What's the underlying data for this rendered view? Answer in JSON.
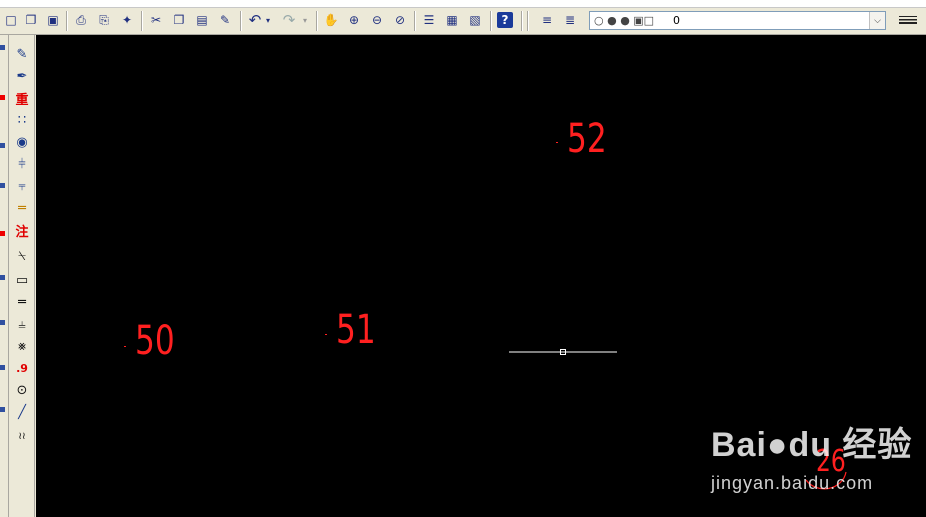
{
  "toolbar": {
    "items": [
      {
        "name": "new-drawing-icon",
        "glyph": "□"
      },
      {
        "name": "open-icon",
        "glyph": "❐"
      },
      {
        "name": "save-icon",
        "glyph": "▣"
      },
      {
        "name": "print-icon",
        "glyph": "⎙"
      },
      {
        "name": "print-preview-icon",
        "glyph": "⎘"
      },
      {
        "name": "publish-icon",
        "glyph": "✦"
      },
      {
        "name": "cut-icon",
        "glyph": "✂"
      },
      {
        "name": "copy-icon",
        "glyph": "❐"
      },
      {
        "name": "paste-icon",
        "glyph": "▤"
      },
      {
        "name": "match-properties-icon",
        "glyph": "✎"
      },
      {
        "name": "undo-icon",
        "glyph": "↶"
      },
      {
        "name": "redo-icon",
        "glyph": "↷"
      },
      {
        "name": "pan-icon",
        "glyph": "✋"
      },
      {
        "name": "zoom-realtime-icon",
        "glyph": "⊕"
      },
      {
        "name": "zoom-window-icon",
        "glyph": "⊖"
      },
      {
        "name": "zoom-previous-icon",
        "glyph": "⊘"
      },
      {
        "name": "properties-icon",
        "glyph": "☰"
      },
      {
        "name": "design-center-icon",
        "glyph": "▦"
      },
      {
        "name": "tool-palettes-icon",
        "glyph": "▧"
      },
      {
        "name": "help-icon",
        "glyph": "?"
      },
      {
        "name": "layer-manager-icon",
        "glyph": "≡"
      },
      {
        "name": "layer-previous-icon",
        "glyph": "≣"
      }
    ]
  },
  "layer": {
    "icons": "○ ● ● ▣□",
    "current": "0",
    "dropdown_arrow": "⌵"
  },
  "side_toolbar": {
    "items": [
      {
        "name": "pencil-tag-icon",
        "glyph": "✎",
        "red": false
      },
      {
        "name": "edit-tag-icon",
        "glyph": "✒",
        "red": false
      },
      {
        "name": "renumber-icon",
        "glyph": "重",
        "red": true
      },
      {
        "name": "grid-points-icon",
        "glyph": "∷",
        "red": false
      },
      {
        "name": "camera-icon",
        "glyph": "◉",
        "red": false
      },
      {
        "name": "column-icon",
        "glyph": "⫩",
        "red": false
      },
      {
        "name": "chart-icon",
        "glyph": "⫧",
        "red": false
      },
      {
        "name": "ruler-icon",
        "glyph": "═",
        "red": false
      },
      {
        "name": "annotate-icon",
        "glyph": "注",
        "red": true
      },
      {
        "name": "polygon-icon",
        "glyph": "⍀",
        "red": false
      },
      {
        "name": "rectangle-icon",
        "glyph": "▭",
        "red": false
      },
      {
        "name": "dimension-icon",
        "glyph": "═",
        "red": false
      },
      {
        "name": "chain-dimension-icon",
        "glyph": "⫨",
        "red": false
      },
      {
        "name": "stair-icon",
        "glyph": "⨳",
        "red": false
      },
      {
        "name": "decimal-icon",
        "glyph": ".9",
        "red": true
      },
      {
        "name": "circle-point-icon",
        "glyph": "⊙",
        "red": false
      },
      {
        "name": "line-icon",
        "glyph": "╱",
        "red": false
      },
      {
        "name": "break-line-icon",
        "glyph": "≀≀",
        "red": false
      }
    ]
  },
  "canvas": {
    "background": "#000000",
    "label_color": "#ff2020",
    "labels": [
      {
        "text": "50"
      },
      {
        "text": "51"
      },
      {
        "text": "52"
      }
    ],
    "line_color": "#ffffff",
    "partial_circle_text": "26"
  },
  "watermark": {
    "brand": "Bai●du 经验",
    "url": "jingyan.baidu.com"
  }
}
